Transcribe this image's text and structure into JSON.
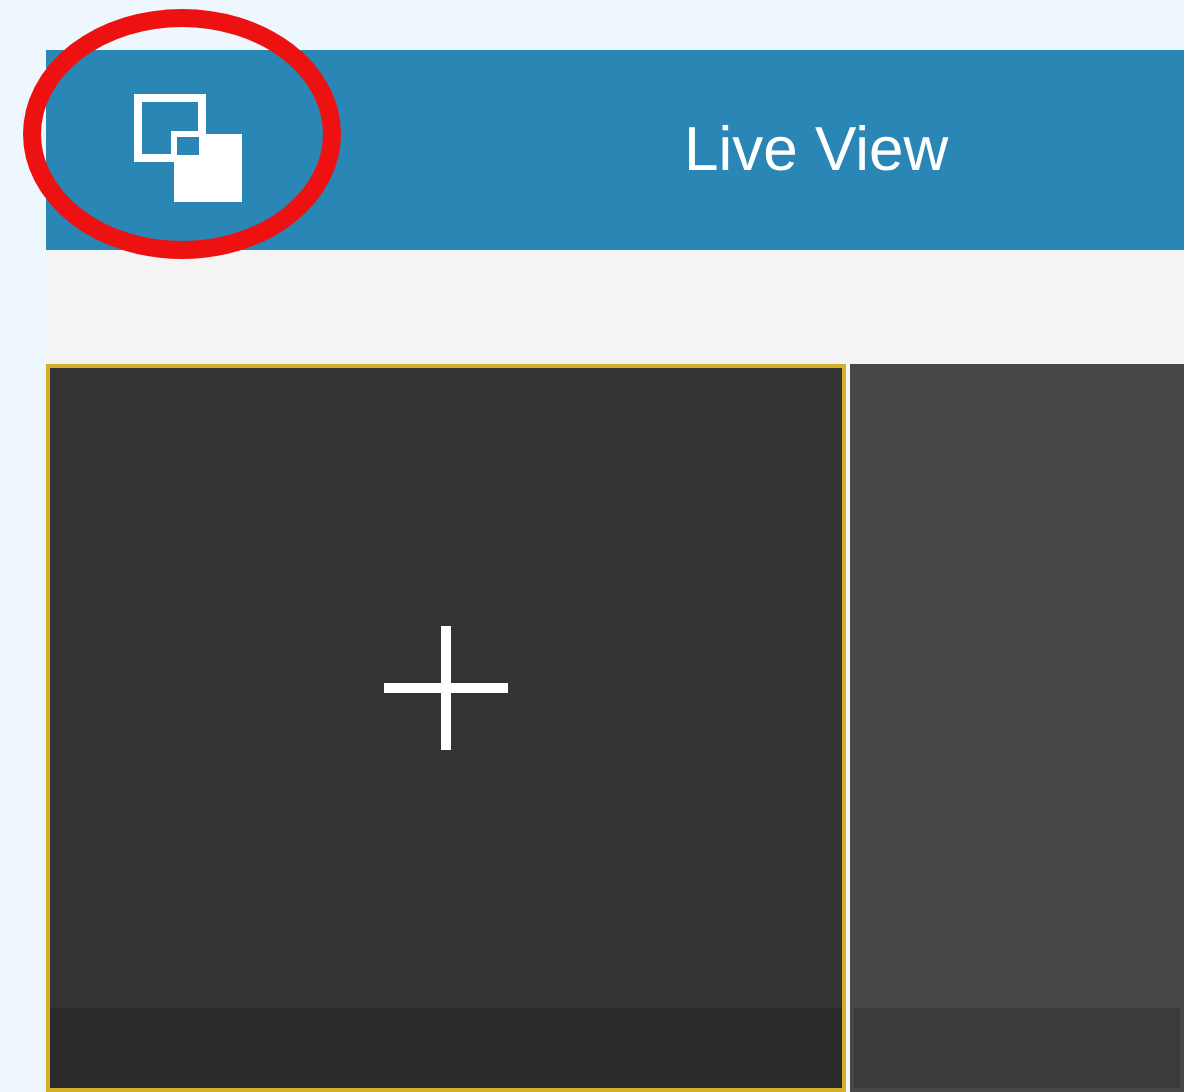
{
  "header": {
    "title": "Live View"
  },
  "tiles": [
    {
      "selected": true
    },
    {
      "selected": false
    }
  ]
}
